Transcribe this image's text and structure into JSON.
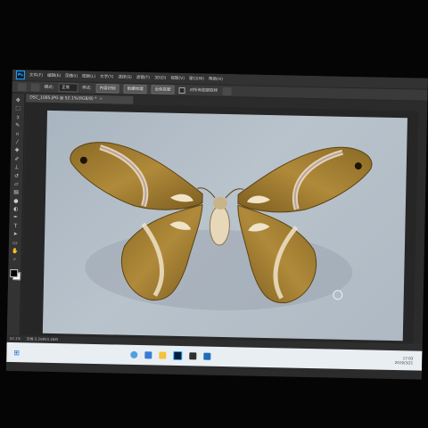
{
  "app": {
    "logo": "Ps",
    "menu": [
      "文件(F)",
      "编辑(E)",
      "图像(I)",
      "图层(L)",
      "文字(Y)",
      "选择(S)",
      "滤镜(T)",
      "3D(D)",
      "视图(V)",
      "窗口(W)",
      "帮助(H)"
    ]
  },
  "options_bar": {
    "mode_label": "模式:",
    "mode_value": "正常",
    "style_label": "样式:",
    "content_aware": "内容识别",
    "create_texture": "创建纹理",
    "proximity_match": "近似匹配",
    "sample_all_layers": "对所有图层取样"
  },
  "document": {
    "tab_title": "DSC_1085.JPG @ 52.1%(RGB/8) *",
    "close": "×"
  },
  "status": {
    "zoom": "52.1%",
    "doc_info": "文档:3.26M/3.26M"
  },
  "tools": [
    "move",
    "marquee",
    "lasso",
    "quick-select",
    "crop",
    "eyedropper",
    "healing",
    "brush",
    "stamp",
    "history-brush",
    "eraser",
    "gradient",
    "blur",
    "dodge",
    "pen",
    "type",
    "path-select",
    "shape",
    "hand",
    "zoom"
  ],
  "taskbar": {
    "start": "⊞",
    "clock_time": "17:03",
    "clock_date": "2019/3/21"
  },
  "colors": {
    "accent": "#31a8ff",
    "moth_gold": "#a57f2f",
    "moth_dark": "#6b4f1a",
    "moth_pale": "#e6d8b8"
  }
}
